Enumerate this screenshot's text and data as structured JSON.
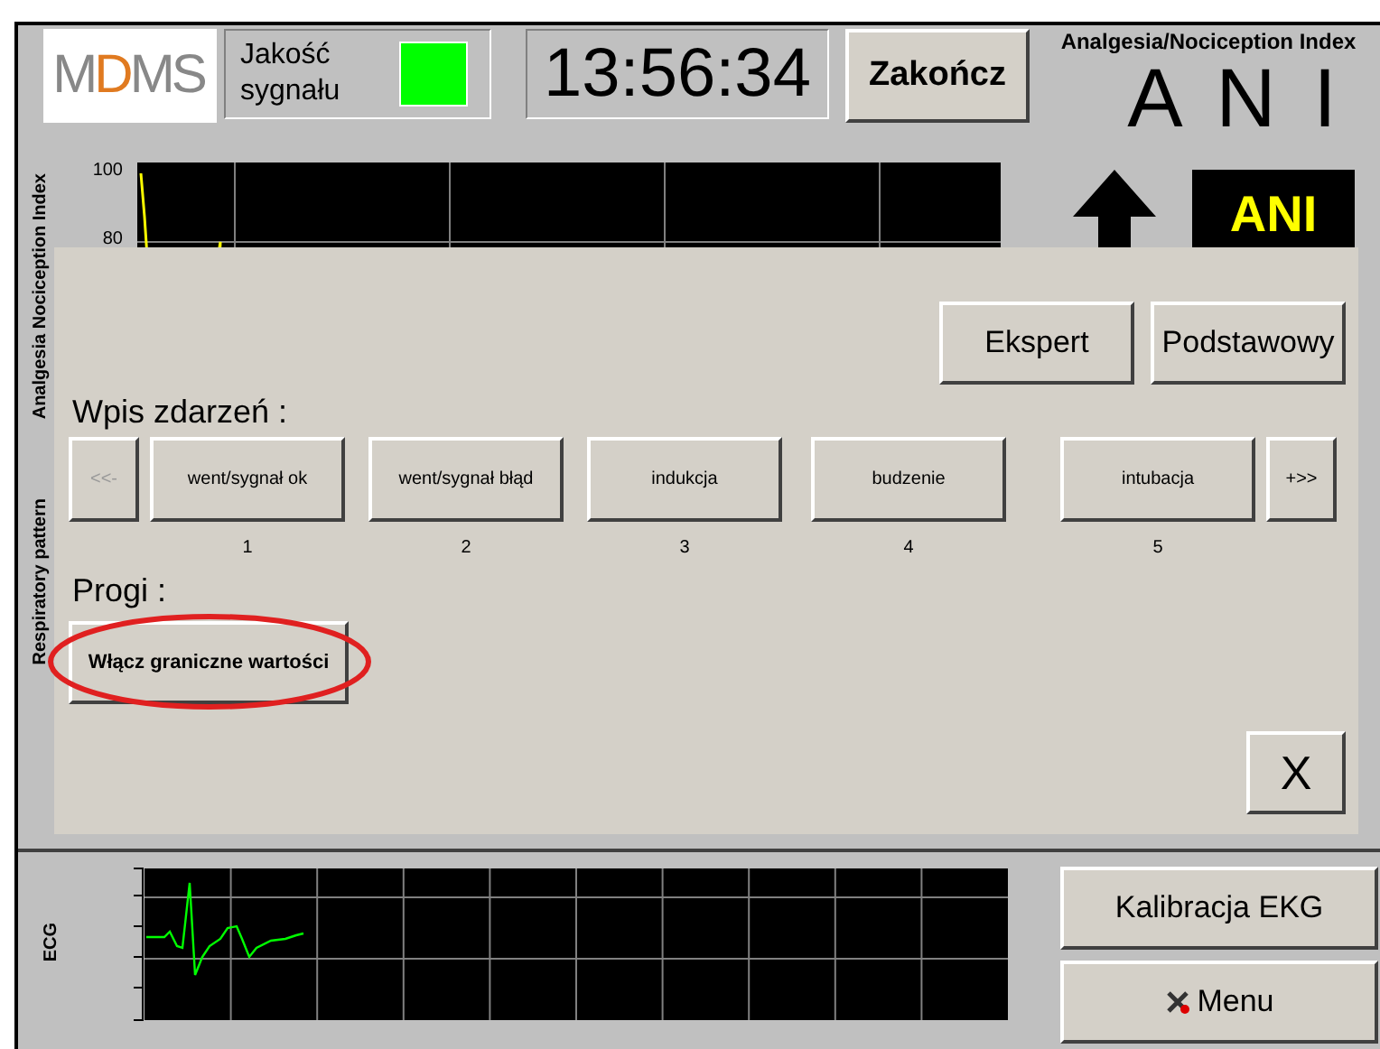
{
  "header": {
    "logo": "MDMS",
    "signal": {
      "label": "Jakość sygnału",
      "ok": true
    },
    "clock": "13:56:34",
    "end_button": "Zakończ"
  },
  "ani_panel": {
    "title": "Analgesia/Nociception Index",
    "name": "A N I",
    "badge": "ANI"
  },
  "trend": {
    "axis_label": "Analgesia Nociception Index",
    "yticks": [
      "100",
      "80"
    ]
  },
  "respiratory": {
    "axis_label": "Respiratory pattern"
  },
  "dialog": {
    "mode_buttons": [
      "Ekspert",
      "Podstawowy"
    ],
    "events_title": "Wpis zdarzeń :",
    "prev": {
      "label": "<<-",
      "disabled": true
    },
    "events": [
      {
        "label": "went/sygnał ok",
        "number": "1"
      },
      {
        "label": "went/sygnał błąd",
        "number": "2"
      },
      {
        "label": "indukcja",
        "number": "3"
      },
      {
        "label": "budzenie",
        "number": "4"
      },
      {
        "label": "intubacja",
        "number": "5"
      }
    ],
    "next": {
      "label": "+>>",
      "disabled": false
    },
    "thresholds_title": "Progi :",
    "threshold_button": {
      "label": "Włącz graniczne wartości",
      "highlighted": true
    },
    "close": "X"
  },
  "ecg": {
    "label": "ECG",
    "calibrate_button": "Kalibracja EKG",
    "menu_button": "Menu"
  }
}
